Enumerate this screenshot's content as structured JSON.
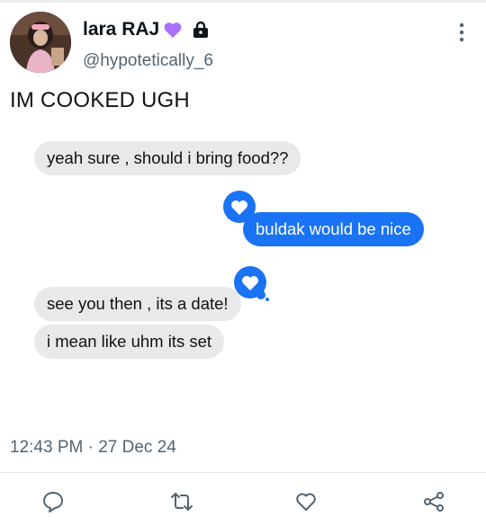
{
  "author": {
    "display_name": "lara RAJ",
    "handle": "@hypotetically_6",
    "badges": [
      "purple-heart-icon",
      "lock-icon"
    ]
  },
  "tweet": {
    "text": "IM COOKED UGH",
    "timestamp": "12:43 PM · 27 Dec 24"
  },
  "messages": [
    {
      "side": "received",
      "text": "yeah sure , should i bring food??"
    },
    {
      "side": "sent",
      "text": "buldak would be nice",
      "reaction": "heart-reaction-icon"
    },
    {
      "side": "received",
      "text": "see you then , its a date!",
      "reaction": "heart-reaction-icon"
    },
    {
      "side": "received",
      "text": "i mean like uhm its set"
    }
  ],
  "actions": [
    "reply-icon",
    "retweet-icon",
    "like-icon",
    "share-icon"
  ],
  "colors": {
    "accent_blue": "#1a73f5",
    "received_bubble": "#e9e9eb",
    "secondary_text": "#536471",
    "heart_badge": "#a970ff"
  }
}
